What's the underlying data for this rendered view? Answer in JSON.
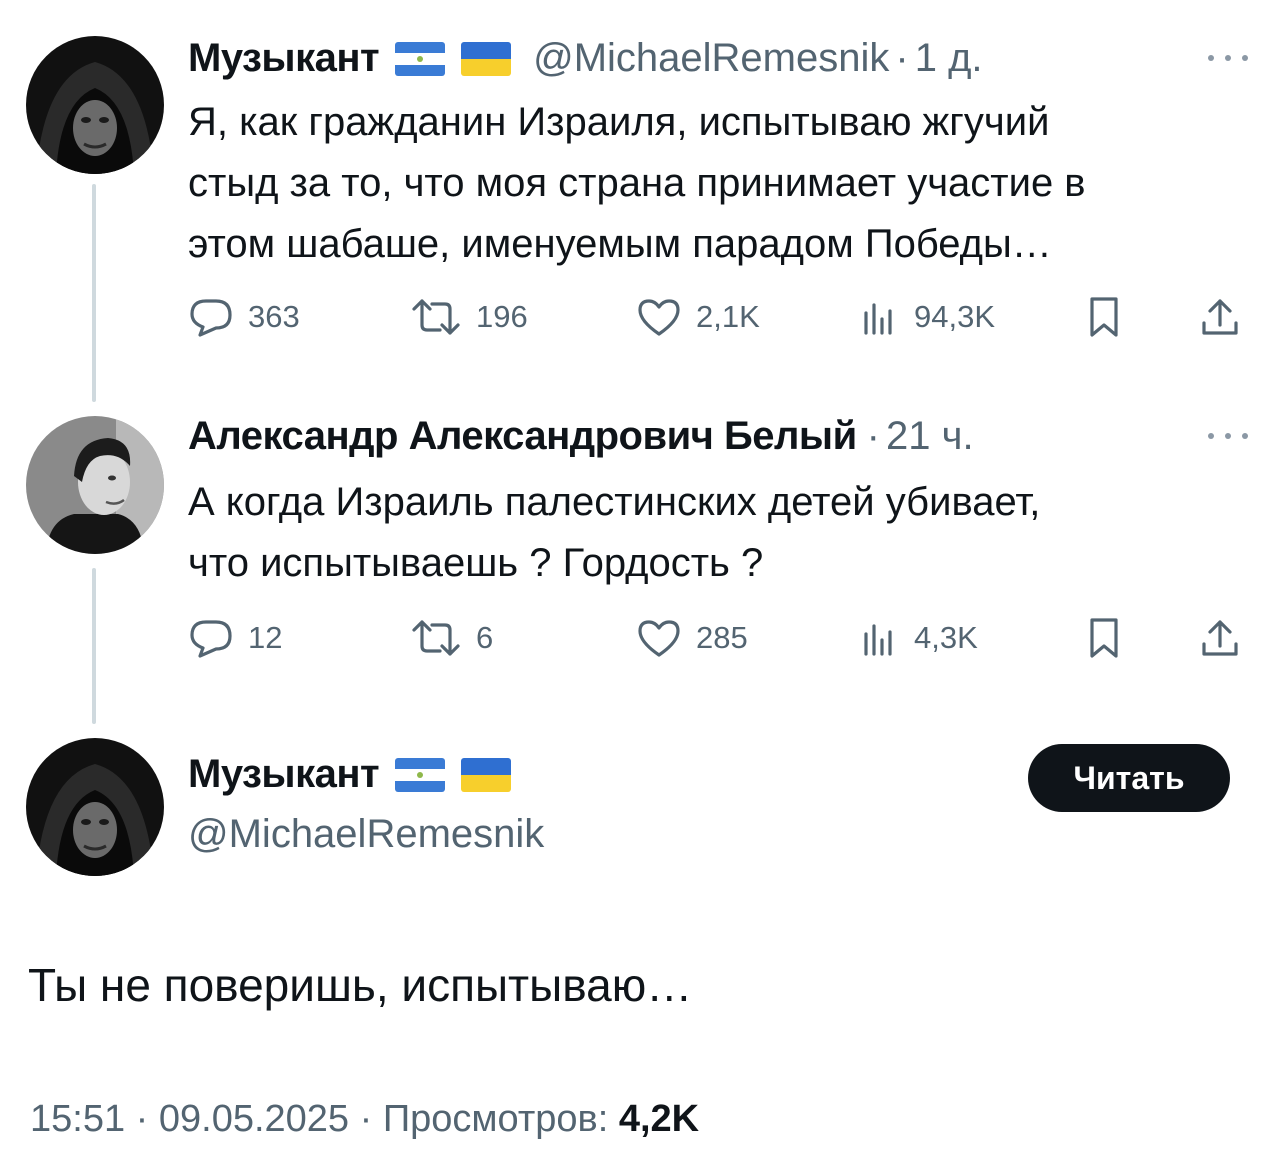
{
  "thread": [
    {
      "author": {
        "name": "Музыкант",
        "flags": [
          "nicaragua-flag",
          "ukraine-flag"
        ],
        "handle": "@MichaelRemesnik",
        "separator": "·",
        "time": "1 д."
      },
      "text_lines": [
        "Я, как гражданин Израиля, испытываю жгучий",
        "стыд за то, что моя страна принимает участие в",
        "этом шабаше, именуемым парадом Победы…"
      ],
      "stats": {
        "replies": "363",
        "retweets": "196",
        "likes": "2,1K",
        "views": "94,3K"
      }
    },
    {
      "author": {
        "name": "Александр Александрович Белый",
        "separator": "·",
        "time": "21 ч."
      },
      "text_lines": [
        "А когда Израиль палестинских детей убивает,",
        "что испытываешь ? Гордость ?"
      ],
      "stats": {
        "replies": "12",
        "retweets": "6",
        "likes": "285",
        "views": "4,3K"
      }
    }
  ],
  "main_tweet": {
    "author": {
      "name": "Музыкант",
      "flags": [
        "nicaragua-flag",
        "ukraine-flag"
      ],
      "handle": "@MichaelRemesnik"
    },
    "follow_button_label": "Читать",
    "text": "Ты не поверишь, испытываю…",
    "meta": {
      "time": "15:51",
      "separator": "·",
      "date": "09.05.2025",
      "views_label": "Просмотров:",
      "views_count": "4,2K"
    }
  },
  "colors": {
    "text": "#0f1419",
    "secondary": "#536471",
    "thread_line": "#cfd9de",
    "button_bg": "#0f1419",
    "button_text": "#ffffff"
  },
  "icons": [
    "reply-icon",
    "retweet-icon",
    "like-icon",
    "views-icon",
    "bookmark-icon",
    "share-icon",
    "more-icon"
  ]
}
